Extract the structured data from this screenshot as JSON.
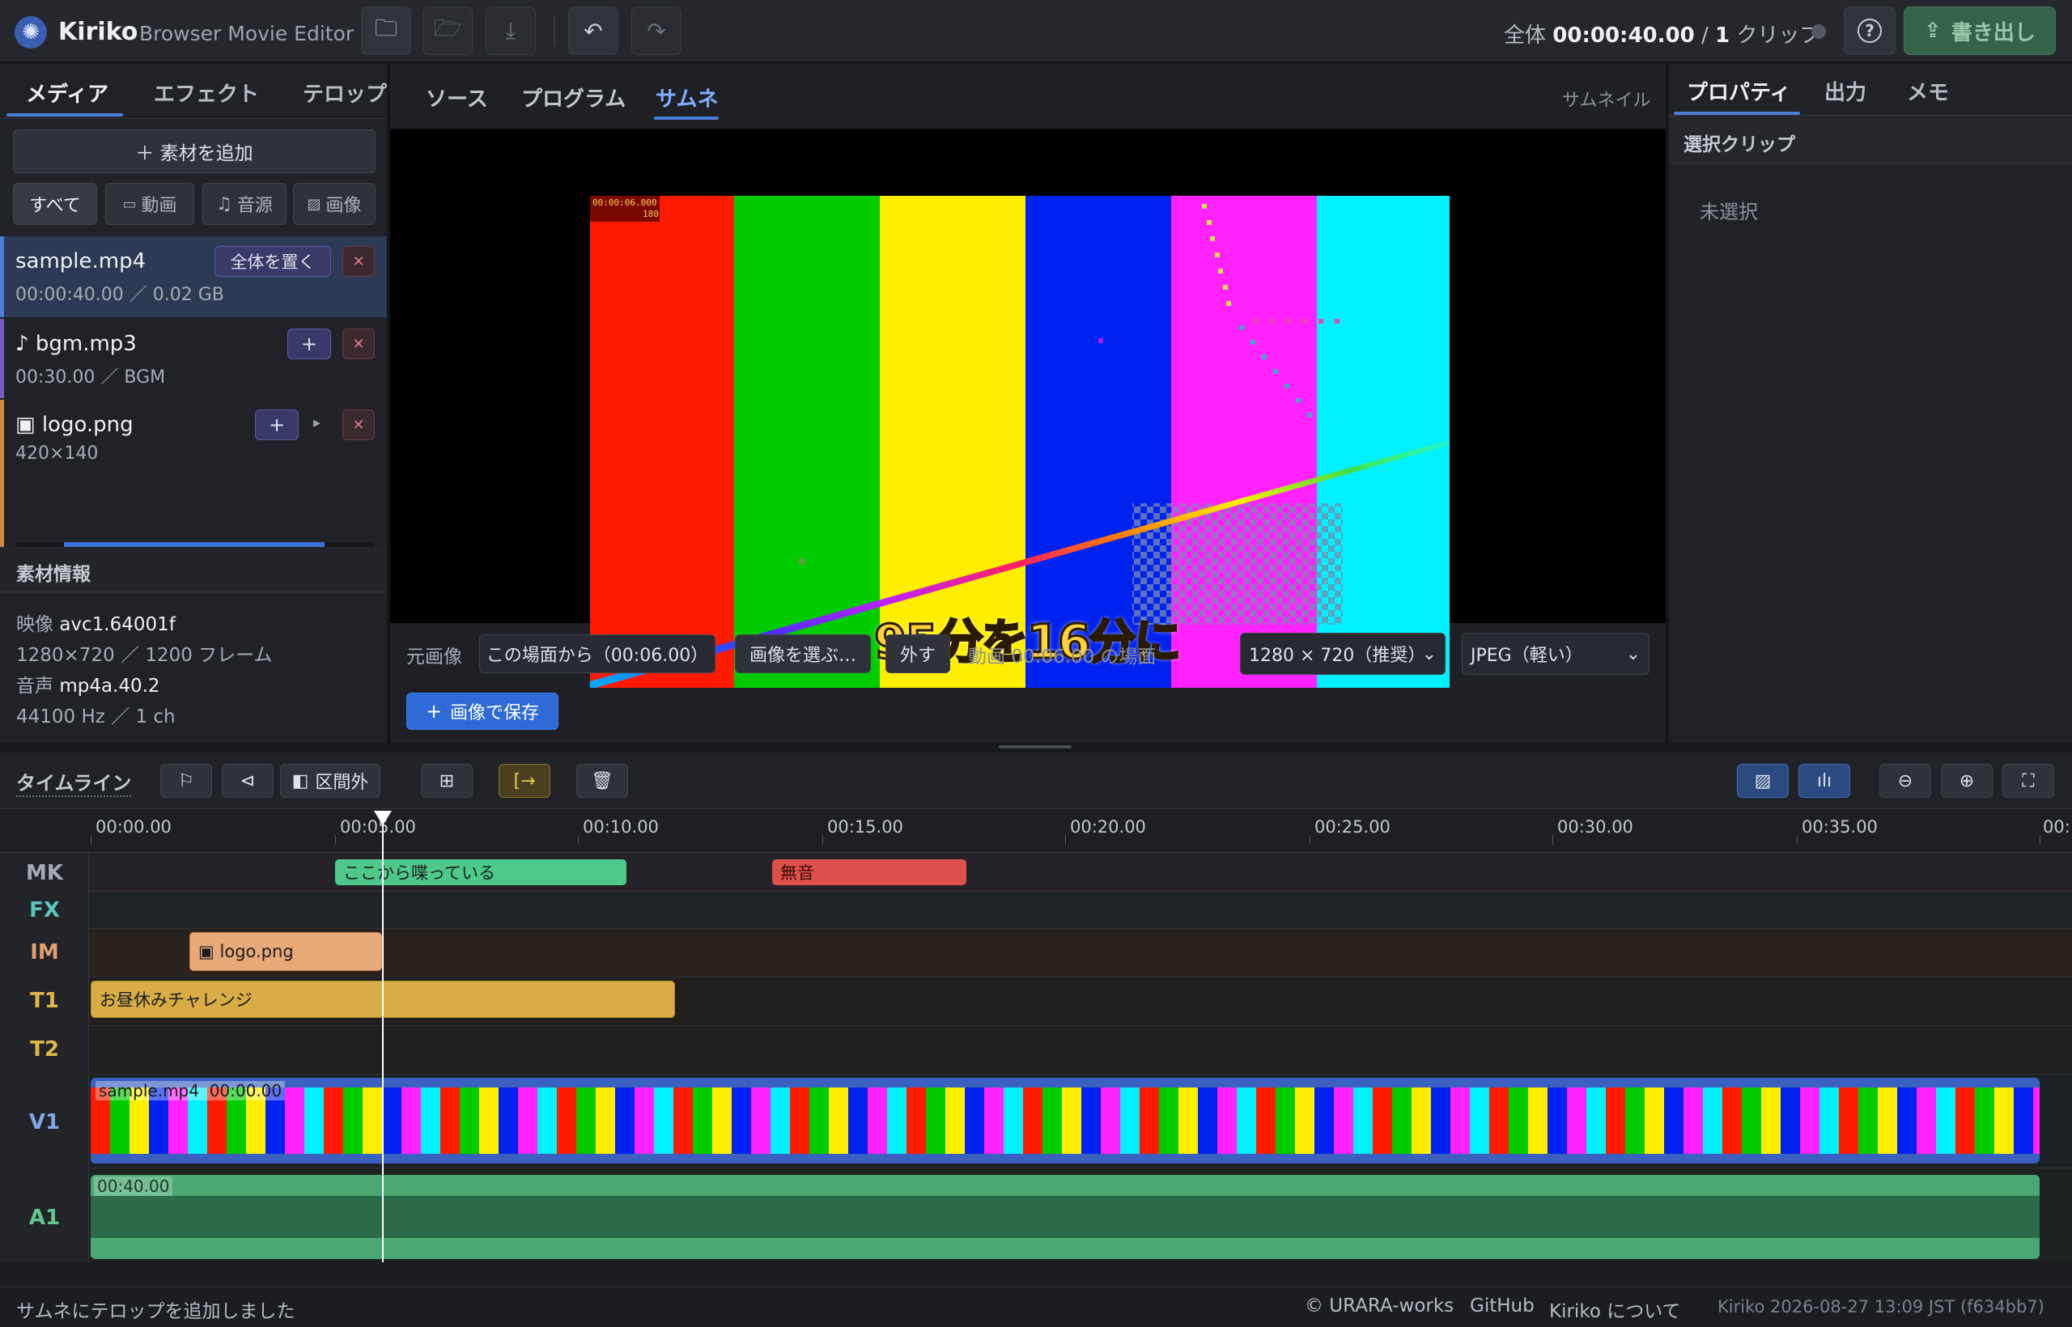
{
  "app": {
    "name": "Kiriko",
    "subtitle": "Browser Movie Editor"
  },
  "topbar": {
    "total_prefix": "全体",
    "total_time": "00:00:40.00",
    "sep": "/",
    "clip_count": "1",
    "clip_suffix": "クリップ",
    "export_label": "書き出し",
    "help_icon": "?"
  },
  "left": {
    "tabs": [
      "メディア",
      "エフェクト",
      "テロップ"
    ],
    "add_label": "＋ 素材を追加",
    "filters": [
      "すべて",
      "動画",
      "音源",
      "画像"
    ],
    "media": [
      {
        "name": "sample.mp4",
        "meta": "00:00:40.00 ／ 0.02 GB",
        "action": "全体を置く"
      },
      {
        "name": "♪ bgm.mp3",
        "meta": "00:30.00 ／ BGM",
        "action": "+"
      },
      {
        "name": "▣ logo.png",
        "meta": "420×140",
        "action": "+"
      }
    ],
    "info_title": "素材情報",
    "info": {
      "video_label": "映像",
      "video_codec": "avc1.64001f",
      "video_meta": "1280×720 ／ 1200 フレーム",
      "audio_label": "音声",
      "audio_codec": "mp4a.40.2",
      "audio_meta": "44100 Hz ／ 1 ch"
    }
  },
  "center": {
    "tabs": [
      "ソース",
      "プログラム",
      "サムネ"
    ],
    "right_label": "サムネイル",
    "overlay_caption": "95分を16分に",
    "timecode_overlay": "00:00:06.000",
    "frame_overlay": "180",
    "source_label": "元画像",
    "from_scene": "この場面から（00:06.00）",
    "choose_image": "画像を選ぶ…",
    "remove": "外す",
    "scene_note": "動画 00:06.00 の場面",
    "size_select": "1280 × 720（推奨）",
    "format_select": "JPEG（軽い）",
    "save_label": "画像で保存"
  },
  "right": {
    "tabs": [
      "プロパティ",
      "出力",
      "メモ"
    ],
    "section": "選択クリップ",
    "empty": "未選択"
  },
  "timeline": {
    "title": "タイムライン",
    "out_of_range": "区間外",
    "ticks": [
      "00:00.00",
      "00:05.00",
      "00:10.00",
      "00:15.00",
      "00:20.00",
      "00:25.00",
      "00:30.00",
      "00:35.00",
      "00:"
    ],
    "tracks": [
      "MK",
      "FX",
      "IM",
      "T1",
      "T2",
      "V1",
      "A1"
    ],
    "markers": [
      {
        "label": "ここから喋っている",
        "color": "#4ec98a"
      },
      {
        "label": "無音",
        "color": "#e0504a"
      }
    ],
    "im_clip": "▣ logo.png",
    "t1_clip": "お昼休みチャレンジ",
    "v1_clip": "sample.mp4  00:00.00",
    "a1_clip": "00:40.00"
  },
  "status": {
    "message": "サムネにテロップを追加しました",
    "copyright": "© URARA-works",
    "github": "GitHub",
    "about": "Kiriko について",
    "build": "Kiriko 2026-08-27 13:09 JST (f634bb7)"
  },
  "colors": {
    "accent": "#4b7fd6",
    "bg": "#1b1d22",
    "panel": "#202227",
    "export": "#3a6b4e"
  }
}
